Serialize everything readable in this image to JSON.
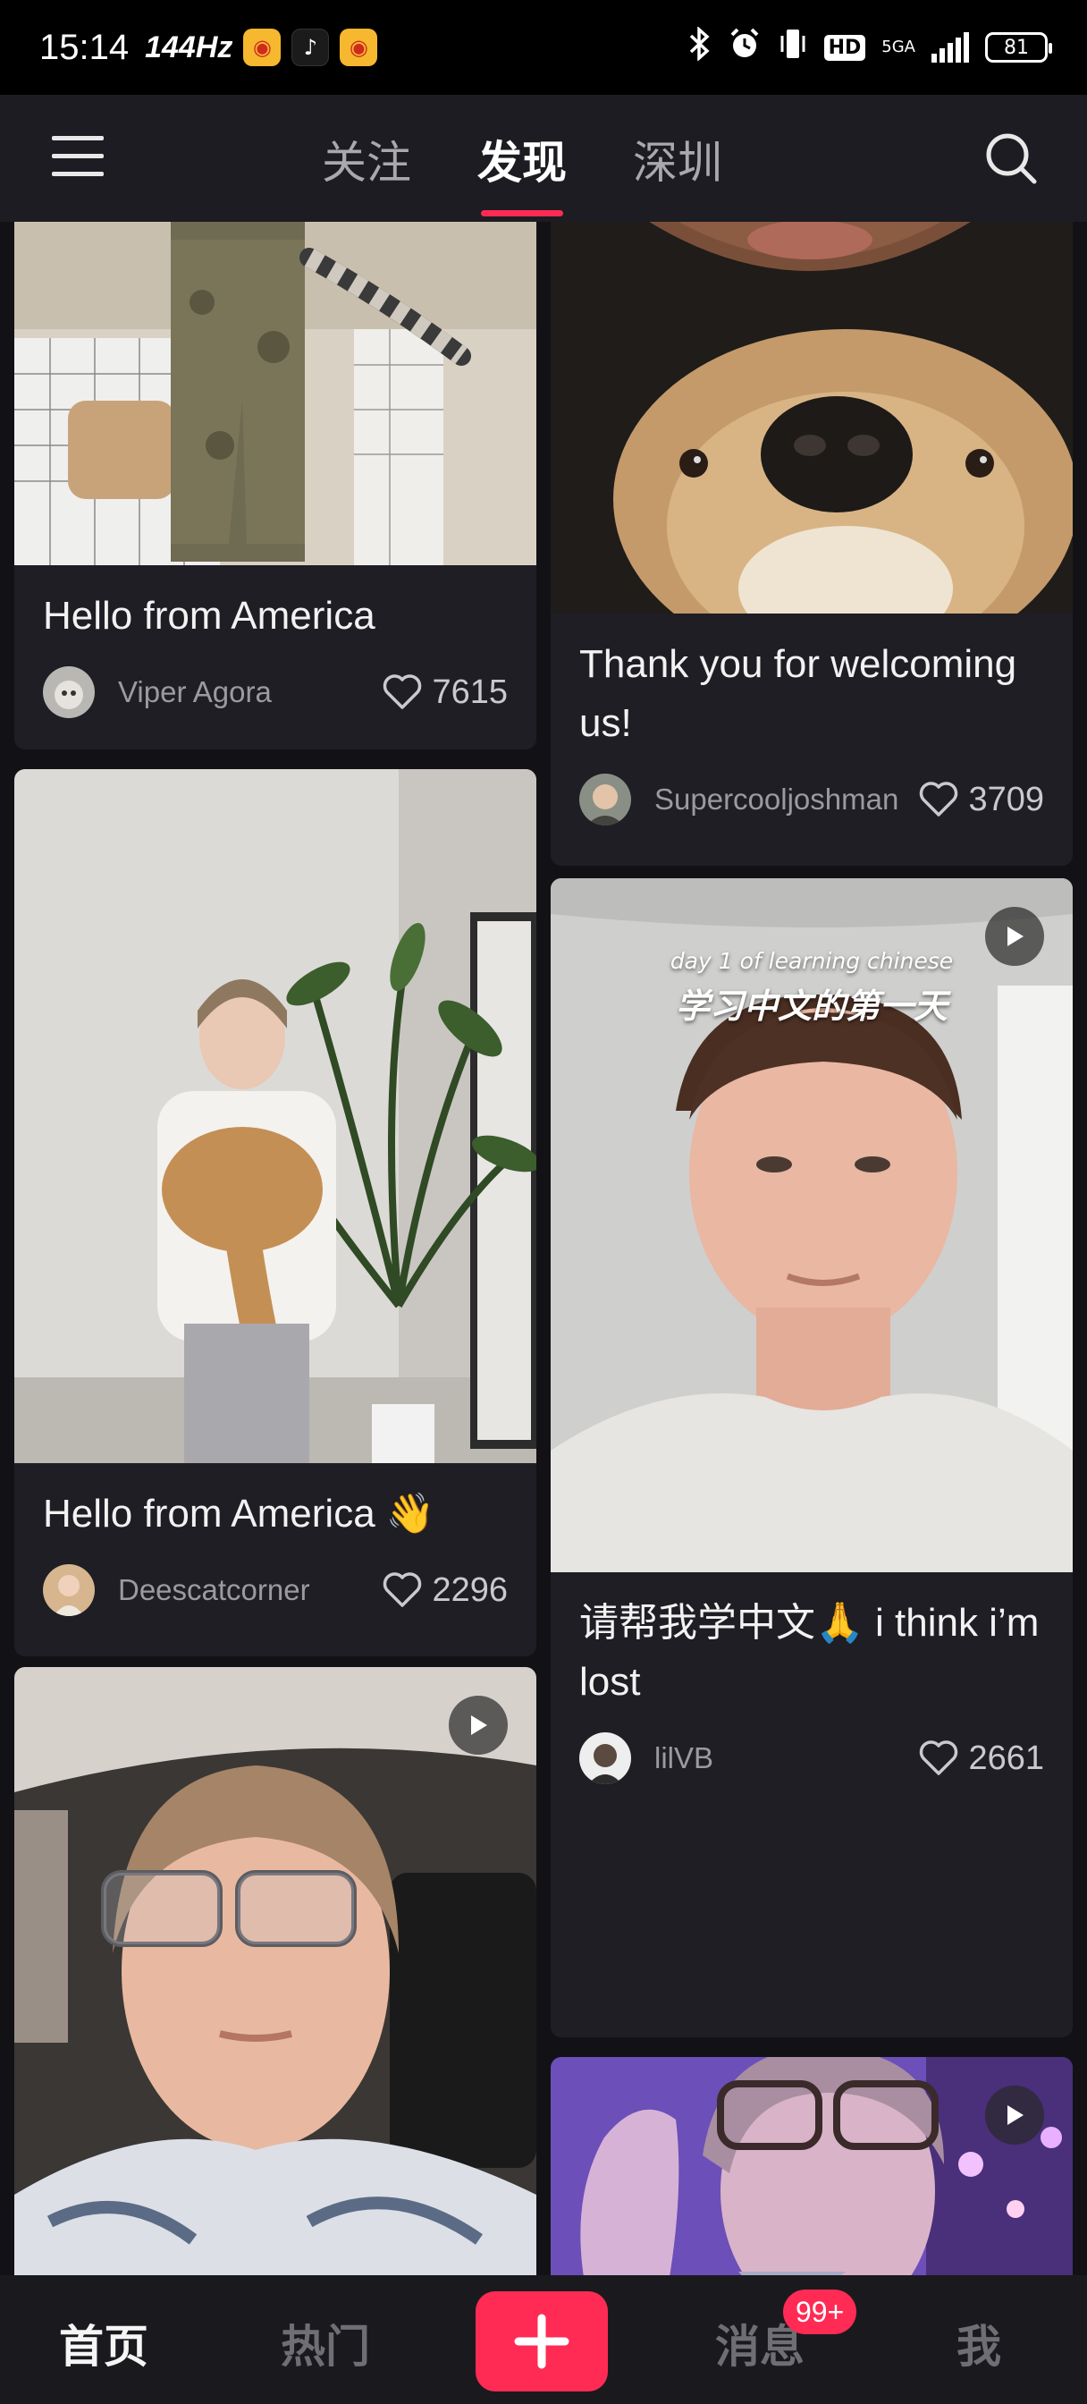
{
  "status_bar": {
    "time": "15:14",
    "refresh_rate": "144Hz",
    "network": "5GA",
    "battery": "81",
    "hd_label": "HD"
  },
  "header": {
    "tabs": [
      {
        "label": "关注",
        "active": false
      },
      {
        "label": "发现",
        "active": true
      },
      {
        "label": "深圳",
        "active": false
      }
    ]
  },
  "feed": {
    "cards": [
      {
        "title": "Hello from America",
        "author": "Viper Agora",
        "likes": "7615"
      },
      {
        "title": "Thank you for welcoming us!",
        "author": "Supercooljoshman",
        "likes": "3709"
      },
      {
        "title": "Hello from America 👋",
        "author": "Deescatcorner",
        "likes": "2296"
      },
      {
        "title": "请帮我学中文🙏 i think i’m lost",
        "author": "lilVB",
        "likes": "2661",
        "overlay_caption_en": "day 1 of learning chinese",
        "overlay_caption_zh": "学习中文的第一天",
        "is_video": true
      },
      {
        "is_video": true
      },
      {
        "is_video": true
      }
    ]
  },
  "bottom_nav": {
    "items": [
      {
        "label": "首页",
        "active": true
      },
      {
        "label": "热门",
        "active": false
      },
      {
        "label": "消息",
        "active": false
      },
      {
        "label": "我",
        "active": false
      }
    ],
    "messages_badge": "99+"
  },
  "colors": {
    "accent": "#ff2b54",
    "background": "#121216",
    "card": "#1e1e24"
  }
}
